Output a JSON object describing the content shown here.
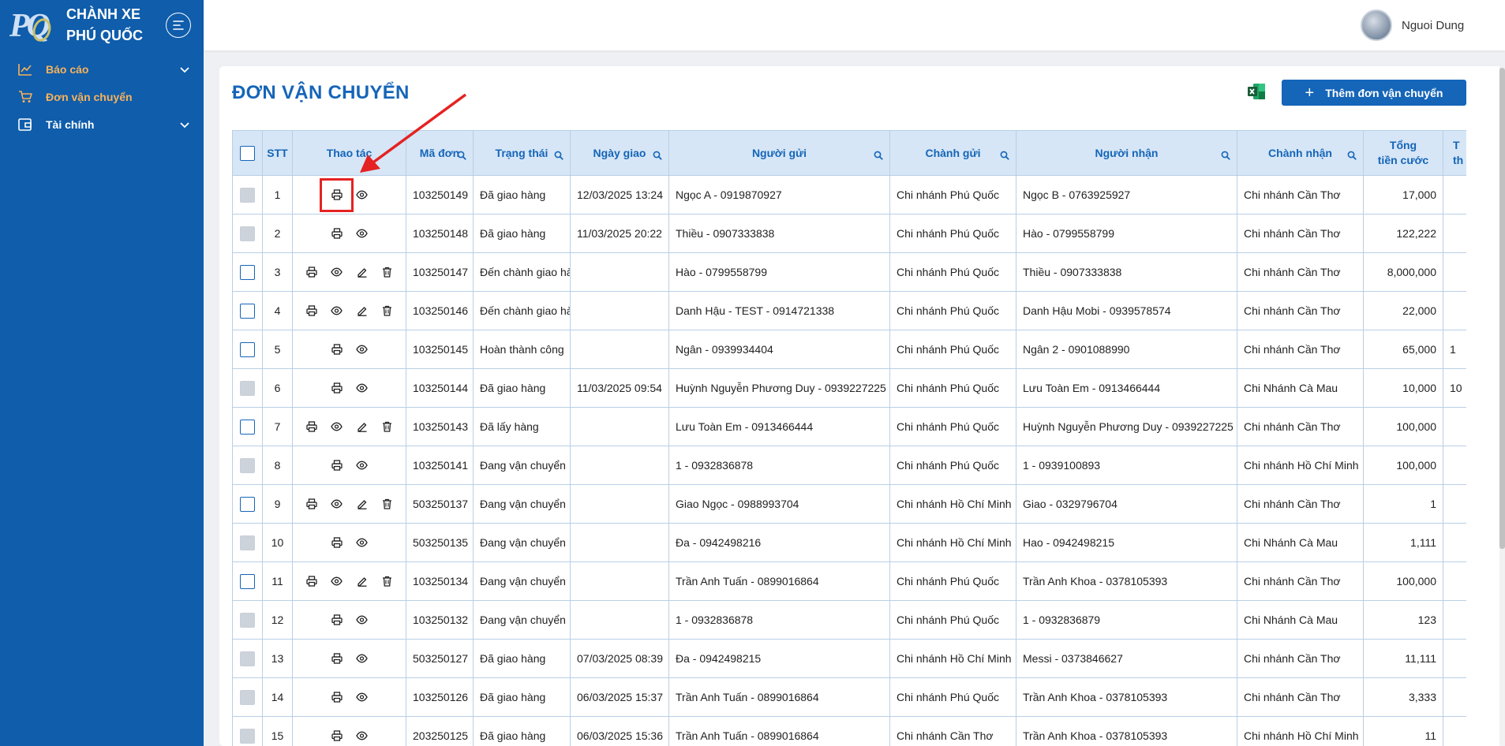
{
  "brand": {
    "line1": "CHÀNH XE",
    "line2": "PHÚ QUỐC",
    "logo": "PQ"
  },
  "sidebar": {
    "items": [
      {
        "label": "Báo cáo",
        "icon": "line-chart-icon"
      },
      {
        "label": "Đơn vận chuyển",
        "icon": "cart-icon"
      },
      {
        "label": "Tài chính",
        "icon": "wallet-icon"
      }
    ]
  },
  "user": {
    "name": "Nguoi Dung"
  },
  "page": {
    "title": "ĐƠN VẬN CHUYỂN",
    "add_button": "Thêm đơn vận chuyển"
  },
  "table": {
    "headers": {
      "stt": "STT",
      "actions": "Thao tác",
      "code": "Mã đơn",
      "status": "Trạng thái",
      "date": "Ngày giao",
      "sender": "Người gửi",
      "from_branch": "Chành gửi",
      "receiver": "Người nhận",
      "to_branch": "Chành nhận",
      "total_1": "Tổng",
      "total_2": "tiền cước",
      "cut_1": "T",
      "cut_2": "th"
    },
    "rows": [
      {
        "stt": "1",
        "code": "103250149",
        "status": "Đã giao hàng",
        "date": "12/03/2025 13:24",
        "sender": "Ngọc A - 0919870927",
        "from_branch": "Chi nhánh Phú Quốc",
        "receiver": "Ngọc B - 0763925927",
        "to_branch": "Chi nhánh Cần Thơ",
        "total": "17,000",
        "extra": ""
      },
      {
        "stt": "2",
        "code": "103250148",
        "status": "Đã giao hàng",
        "date": "11/03/2025 20:22",
        "sender": "Thiều - 0907333838",
        "from_branch": "Chi nhánh Phú Quốc",
        "receiver": "Hào - 0799558799",
        "to_branch": "Chi nhánh Cần Thơ",
        "total": "122,222",
        "extra": ""
      },
      {
        "stt": "3",
        "code": "103250147",
        "status": "Đến chành giao hàng",
        "date": "",
        "sender": "Hào - 0799558799",
        "from_branch": "Chi nhánh Phú Quốc",
        "receiver": "Thiều - 0907333838",
        "to_branch": "Chi nhánh Cần Thơ",
        "total": "8,000,000",
        "extra": ""
      },
      {
        "stt": "4",
        "code": "103250146",
        "status": "Đến chành giao hàng",
        "date": "",
        "sender": "Danh Hậu - TEST - 0914721338",
        "from_branch": "Chi nhánh Phú Quốc",
        "receiver": "Danh Hậu Mobi - 0939578574",
        "to_branch": "Chi nhánh Cần Thơ",
        "total": "22,000",
        "extra": ""
      },
      {
        "stt": "5",
        "code": "103250145",
        "status": "Hoàn thành công",
        "date": "",
        "sender": "Ngân - 0939934404",
        "from_branch": "Chi nhánh Phú Quốc",
        "receiver": "Ngân 2 - 0901088990",
        "to_branch": "Chi nhánh Cần Thơ",
        "total": "65,000",
        "extra": "1"
      },
      {
        "stt": "6",
        "code": "103250144",
        "status": "Đã giao hàng",
        "date": "11/03/2025 09:54",
        "sender": "Huỳnh Nguyễn Phương Duy - 0939227225",
        "from_branch": "Chi nhánh Phú Quốc",
        "receiver": "Lưu Toàn Em - 0913466444",
        "to_branch": "Chi Nhánh Cà Mau",
        "total": "10,000",
        "extra": "10"
      },
      {
        "stt": "7",
        "code": "103250143",
        "status": "Đã lấy hàng",
        "date": "",
        "sender": "Lưu Toàn Em - 0913466444",
        "from_branch": "Chi nhánh Phú Quốc",
        "receiver": "Huỳnh Nguyễn Phương Duy - 0939227225",
        "to_branch": "Chi nhánh Cần Thơ",
        "total": "100,000",
        "extra": ""
      },
      {
        "stt": "8",
        "code": "103250141",
        "status": "Đang vận chuyển",
        "date": "",
        "sender": "1 - 0932836878",
        "from_branch": "Chi nhánh Phú Quốc",
        "receiver": "1 - 0939100893",
        "to_branch": "Chi nhánh Hồ Chí Minh",
        "total": "100,000",
        "extra": ""
      },
      {
        "stt": "9",
        "code": "503250137",
        "status": "Đang vận chuyển",
        "date": "",
        "sender": "Giao Ngọc - 0988993704",
        "from_branch": "Chi nhánh Hồ Chí Minh",
        "receiver": "Giao - 0329796704",
        "to_branch": "Chi nhánh Cần Thơ",
        "total": "1",
        "extra": ""
      },
      {
        "stt": "10",
        "code": "503250135",
        "status": "Đang vận chuyển",
        "date": "",
        "sender": "Đa - 0942498216",
        "from_branch": "Chi nhánh Hồ Chí Minh",
        "receiver": "Hao - 0942498215",
        "to_branch": "Chi Nhánh Cà Mau",
        "total": "1,111",
        "extra": ""
      },
      {
        "stt": "11",
        "code": "103250134",
        "status": "Đang vận chuyển",
        "date": "",
        "sender": "Trần Anh Tuấn - 0899016864",
        "from_branch": "Chi nhánh Phú Quốc",
        "receiver": "Trần Anh Khoa - 0378105393",
        "to_branch": "Chi nhánh Cần Thơ",
        "total": "100,000",
        "extra": ""
      },
      {
        "stt": "12",
        "code": "103250132",
        "status": "Đang vận chuyển",
        "date": "",
        "sender": "1 - 0932836878",
        "from_branch": "Chi nhánh Phú Quốc",
        "receiver": "1 - 0932836879",
        "to_branch": "Chi Nhánh Cà Mau",
        "total": "123",
        "extra": ""
      },
      {
        "stt": "13",
        "code": "503250127",
        "status": "Đã giao hàng",
        "date": "07/03/2025 08:39",
        "sender": "Đa - 0942498215",
        "from_branch": "Chi nhánh Hồ Chí Minh",
        "receiver": "Messi - 0373846627",
        "to_branch": "Chi nhánh Cần Thơ",
        "total": "11,111",
        "extra": ""
      },
      {
        "stt": "14",
        "code": "103250126",
        "status": "Đã giao hàng",
        "date": "06/03/2025 15:37",
        "sender": "Trần Anh Tuấn - 0899016864",
        "from_branch": "Chi nhánh Phú Quốc",
        "receiver": "Trần Anh Khoa - 0378105393",
        "to_branch": "Chi nhánh Cần Thơ",
        "total": "3,333",
        "extra": ""
      },
      {
        "stt": "15",
        "code": "203250125",
        "status": "Đã giao hàng",
        "date": "06/03/2025 15:36",
        "sender": "Trần Anh Tuấn - 0899016864",
        "from_branch": "Chi nhánh Cần Thơ",
        "receiver": "Trần Anh Khoa - 0378105393",
        "to_branch": "Chi nhánh Hồ Chí Minh",
        "total": "11",
        "extra": ""
      }
    ]
  },
  "colors": {
    "sidebar": "#0f5dab",
    "accent": "#1565b8",
    "header_bg": "#d6e6f6",
    "highlight": "#e52222",
    "menu_active": "#f7b25a"
  }
}
